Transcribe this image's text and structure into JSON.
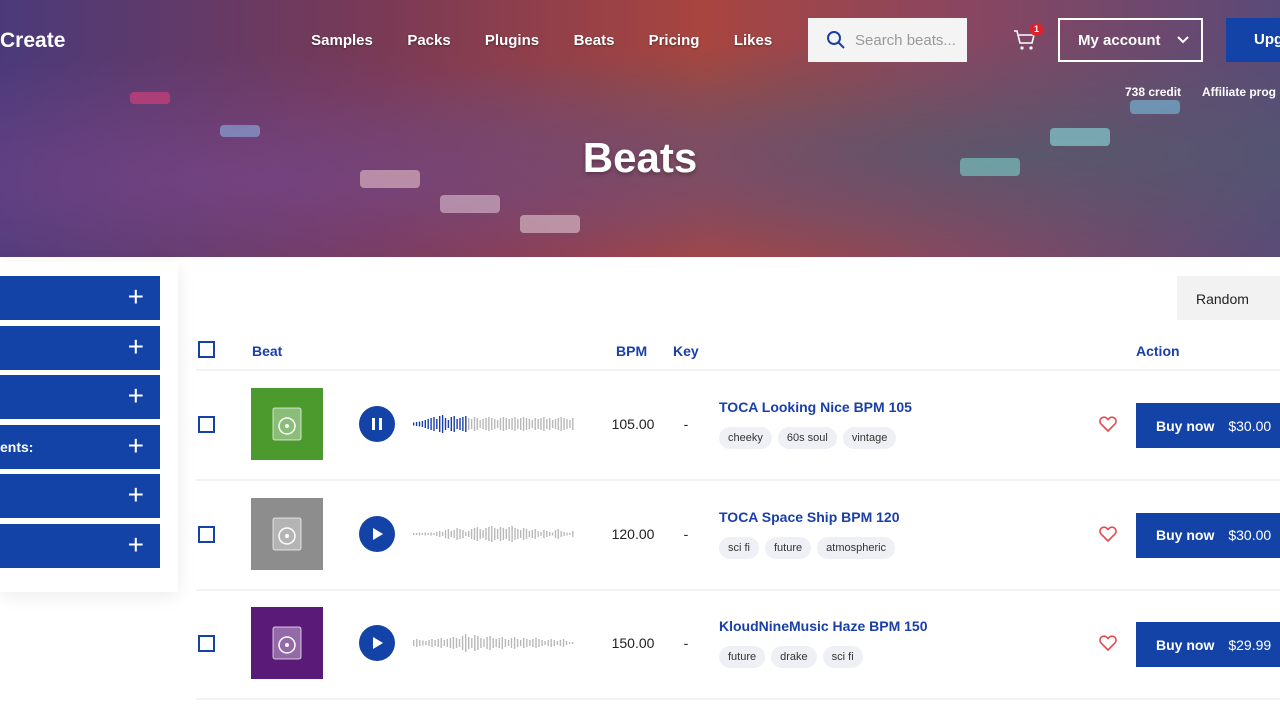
{
  "header": {
    "logo": "Create",
    "nav": [
      "Samples",
      "Packs",
      "Plugins",
      "Beats",
      "Pricing",
      "Likes"
    ],
    "search_placeholder": "Search beats...",
    "cart_count": "1",
    "account_label": "My account",
    "upgrade_label": "Upg",
    "credit": "738 credit",
    "affiliate": "Affiliate prog"
  },
  "page_title": "Beats",
  "sidebar": {
    "filters": [
      "",
      "",
      "",
      "ents:",
      "",
      ""
    ]
  },
  "sort": {
    "selected": "Random"
  },
  "table": {
    "headers": {
      "beat": "Beat",
      "bpm": "BPM",
      "key": "Key",
      "action": "Action"
    },
    "rows": [
      {
        "title": "TOCA Looking Nice BPM 105",
        "bpm": "105.00",
        "key": "-",
        "tags": [
          "cheeky",
          "60s soul",
          "vintage"
        ],
        "buy_label": "Buy now",
        "price": "$30.00",
        "playing": true,
        "progress": 0.33,
        "thumb_color": "#4c9a2e"
      },
      {
        "title": "TOCA Space Ship BPM 120",
        "bpm": "120.00",
        "key": "-",
        "tags": [
          "sci fi",
          "future",
          "atmospheric"
        ],
        "buy_label": "Buy now",
        "price": "$30.00",
        "playing": false,
        "progress": 0,
        "thumb_color": "#8d8d8d"
      },
      {
        "title": "KloudNineMusic Haze BPM 150",
        "bpm": "150.00",
        "key": "-",
        "tags": [
          "future",
          "drake",
          "sci fi"
        ],
        "buy_label": "Buy now",
        "price": "$29.99",
        "playing": false,
        "progress": 0,
        "thumb_color": "#5a1a78"
      }
    ]
  },
  "colors": {
    "accent": "#1443a8",
    "heart": "#e5484d",
    "badge": "#e0202a"
  }
}
